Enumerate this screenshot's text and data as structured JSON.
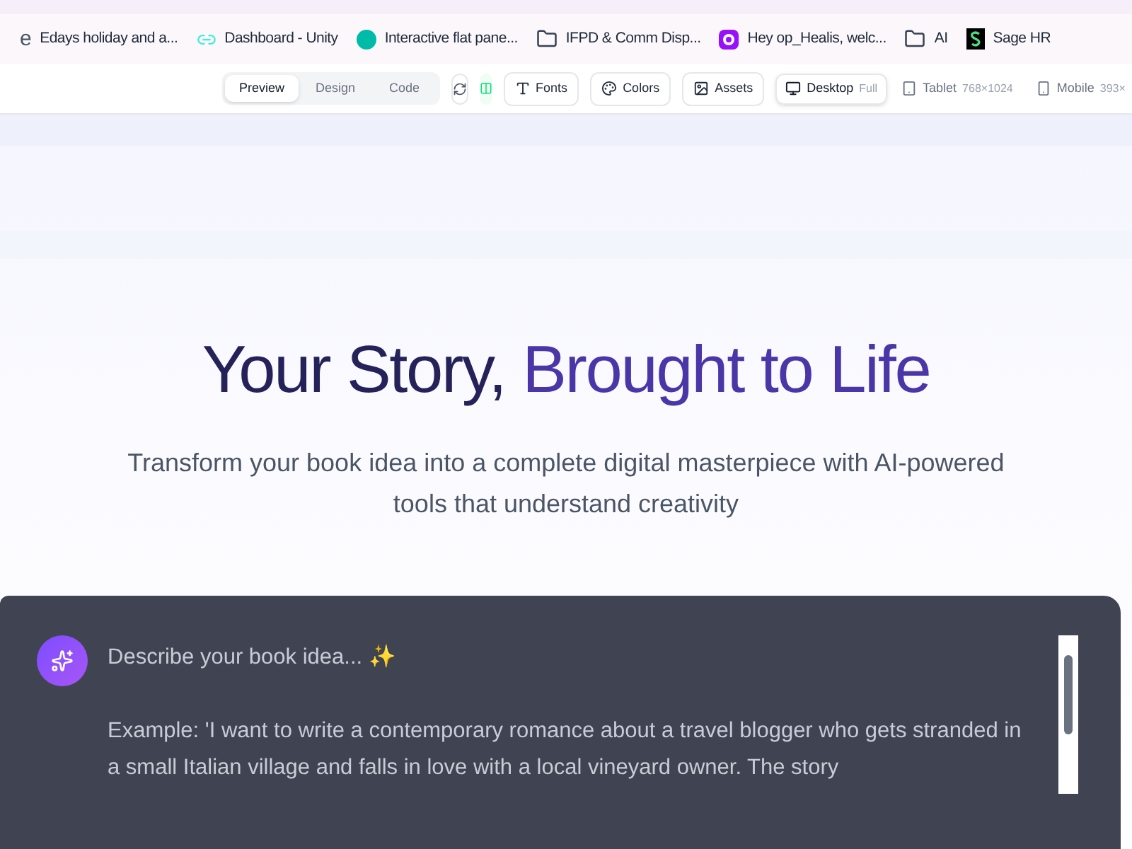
{
  "bookmarks": [
    {
      "kind": "e",
      "label": "Edays holiday and a..."
    },
    {
      "kind": "link",
      "label": "Dashboard - Unity"
    },
    {
      "kind": "circle",
      "label": "Interactive flat pane..."
    },
    {
      "kind": "folder",
      "label": "IFPD & Comm Disp..."
    },
    {
      "kind": "ring",
      "label": "Hey op_Healis, welc..."
    },
    {
      "kind": "folder",
      "label": "AI"
    },
    {
      "kind": "s",
      "label": "Sage HR"
    }
  ],
  "view_tabs": [
    {
      "label": "Preview",
      "selected": true
    },
    {
      "label": "Design",
      "selected": false
    },
    {
      "label": "Code",
      "selected": false
    }
  ],
  "tool_buttons": [
    {
      "kind": "fonts",
      "label": "Fonts"
    },
    {
      "kind": "colors",
      "label": "Colors"
    },
    {
      "kind": "assets",
      "label": "Assets"
    }
  ],
  "devices": [
    {
      "kind": "desktop",
      "label": "Desktop",
      "size": "Full",
      "selected": true
    },
    {
      "kind": "tablet",
      "label": "Tablet",
      "size": "768×1024",
      "selected": false
    },
    {
      "kind": "mobile",
      "label": "Mobile",
      "size": "393×",
      "selected": false
    }
  ],
  "hero": {
    "title_start": "Your Story, ",
    "title_accent": "Brought to Life",
    "subtitle": "Transform your book idea into a complete digital masterpiece with AI-powered tools that understand creativity"
  },
  "prompt": {
    "placeholder": "Describe your book idea... ✨\n\nExample: 'I want to write a contemporary romance about a travel blogger who gets stranded in a small Italian village and falls in love with a local vineyard owner. The story"
  }
}
